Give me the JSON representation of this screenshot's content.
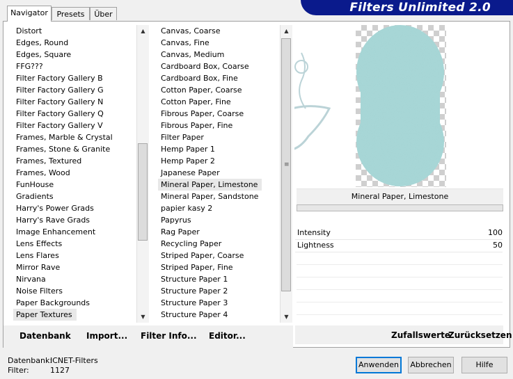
{
  "tabs": [
    {
      "label": "Navigator"
    },
    {
      "label": "Presets"
    },
    {
      "label": "Über"
    }
  ],
  "banner": {
    "title": "Filters Unlimited 2.0"
  },
  "categories": [
    "Distort",
    "Edges, Round",
    "Edges, Square",
    "FFG???",
    "Filter Factory Gallery B",
    "Filter Factory Gallery G",
    "Filter Factory Gallery N",
    "Filter Factory Gallery Q",
    "Filter Factory Gallery V",
    "Frames, Marble & Crystal",
    "Frames, Stone & Granite",
    "Frames, Textured",
    "Frames, Wood",
    "FunHouse",
    "Gradients",
    "Harry's Power Grads",
    "Harry's Rave Grads",
    "Image Enhancement",
    "Lens Effects",
    "Lens Flares",
    "Mirror Rave",
    "Nirvana",
    "Noise Filters",
    "Paper Backgrounds",
    "Paper Textures"
  ],
  "category_selected": "Paper Textures",
  "filters": [
    "Canvas, Coarse",
    "Canvas, Fine",
    "Canvas, Medium",
    "Cardboard Box, Coarse",
    "Cardboard Box, Fine",
    "Cotton Paper, Coarse",
    "Cotton Paper, Fine",
    "Fibrous Paper, Coarse",
    "Fibrous Paper, Fine",
    "Filter Paper",
    "Hemp Paper 1",
    "Hemp Paper 2",
    "Japanese Paper",
    "Mineral Paper, Limestone",
    "Mineral Paper, Sandstone",
    "papier kasy 2",
    "Papyrus",
    "Rag Paper",
    "Recycling Paper",
    "Striped Paper, Coarse",
    "Striped Paper, Fine",
    "Structure Paper 1",
    "Structure Paper 2",
    "Structure Paper 3",
    "Structure Paper 4"
  ],
  "filter_selected": "Mineral Paper, Limestone",
  "buttons_left": {
    "datenbank": "Datenbank",
    "import": "Import...",
    "filter_info": "Filter Info...",
    "editor": "Editor..."
  },
  "preview": {
    "filter_name": "Mineral Paper, Limestone",
    "blob_color": "#a9d9d9"
  },
  "params": [
    {
      "label": "Intensity",
      "value": "100"
    },
    {
      "label": "Lightness",
      "value": "50"
    }
  ],
  "param_buttons": {
    "random": "Zufallswerte",
    "reset": "Zurücksetzen"
  },
  "footer": {
    "db_label": "Datenbank:",
    "db_value": "ICNET-Filters",
    "filter_label": "Filter:",
    "filter_value": "1127"
  },
  "dialog_buttons": {
    "apply": "Anwenden",
    "cancel": "Abbrechen",
    "help": "Hilfe"
  }
}
